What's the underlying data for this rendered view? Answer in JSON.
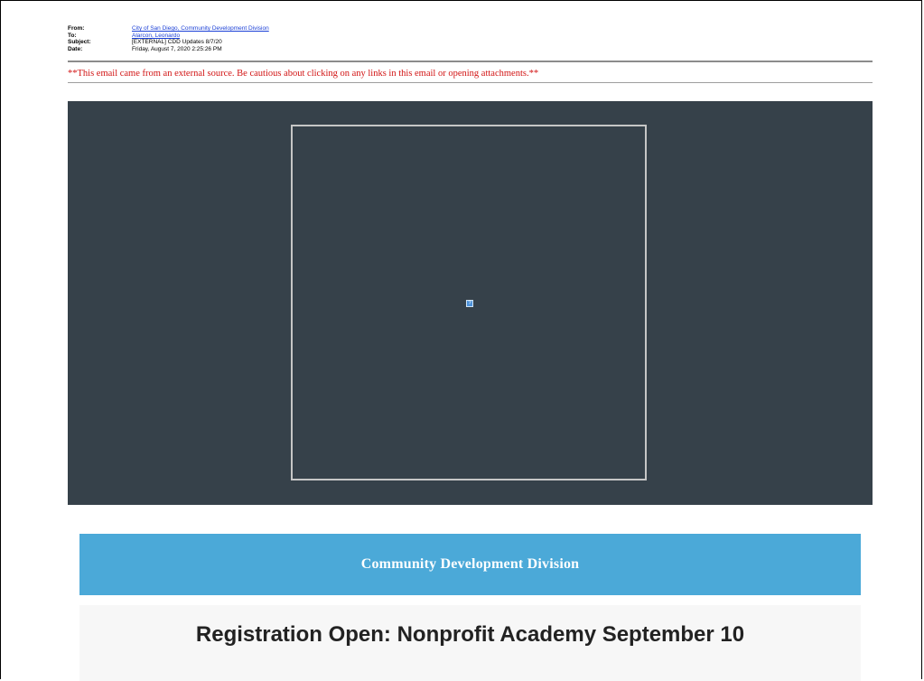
{
  "email_header": {
    "from_label": "From:",
    "from_value": "City of San Diego, Community Development Division",
    "to_label": "To:",
    "to_value": "Alarcon, Leonardo",
    "subject_label": "Subject:",
    "subject_value": "[EXTERNAL] CDD Updates 8/7/20",
    "date_label": "Date:",
    "date_value": "Friday, August 7, 2020 2:25:26 PM"
  },
  "warning_text": "**This email came from an external source. Be cautious about clicking on any links in this email or opening attachments.**",
  "banner": {
    "background_color": "#36414a",
    "image_placeholder_icon": "broken-image-icon",
    "image_placeholder_glyph": "?"
  },
  "division_bar": {
    "title": "Community Development Division",
    "color": "#4ba9d8"
  },
  "headline": "Registration Open: Nonprofit Academy September 10"
}
